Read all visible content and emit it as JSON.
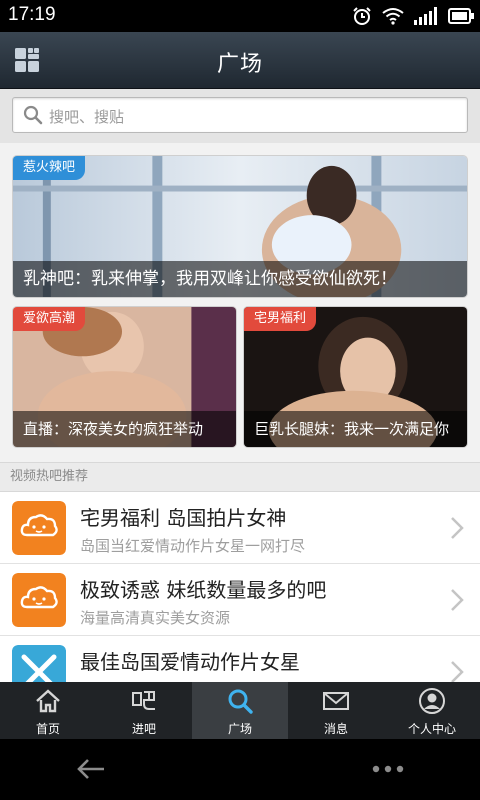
{
  "status_bar": {
    "time": "17:19"
  },
  "header": {
    "title": "广场"
  },
  "search": {
    "placeholder": "搜吧、搜贴"
  },
  "featured": [
    {
      "tag": "惹火辣吧",
      "caption": "乳神吧：乳来伸掌，我用双峰让你感受欲仙欲死！"
    },
    {
      "tag": "爱欲高潮",
      "caption": "直播：深夜美女的疯狂举动"
    },
    {
      "tag": "宅男福利",
      "caption": "巨乳长腿妹：我来一次满足你"
    }
  ],
  "section": {
    "title": "视频热吧推荐"
  },
  "list": [
    {
      "title": "宅男福利 岛国拍片女神",
      "subtitle": "岛国当红爱情动作片女星一网打尽",
      "icon": "cloud-face-icon"
    },
    {
      "title": "极致诱惑 妹纸数量最多的吧",
      "subtitle": "海量高清真实美女资源",
      "icon": "cloud-face-icon"
    },
    {
      "title": "最佳岛国爱情动作片女星",
      "subtitle": "",
      "icon": "crossed-sticks-icon"
    }
  ],
  "tabs": [
    {
      "label": "首页",
      "icon": "home-icon"
    },
    {
      "label": "进吧",
      "icon": "ba-icon"
    },
    {
      "label": "广场",
      "icon": "search-icon",
      "active": true
    },
    {
      "label": "消息",
      "icon": "mail-icon"
    },
    {
      "label": "个人中心",
      "icon": "user-icon"
    }
  ],
  "colors": {
    "tag_blue": "#2f8fd8",
    "tag_red": "#e24a3c",
    "item_icon_orange": "#f2821f",
    "item_icon_blue": "#38a8d8",
    "tab_active_icon": "#3fb3ef"
  }
}
